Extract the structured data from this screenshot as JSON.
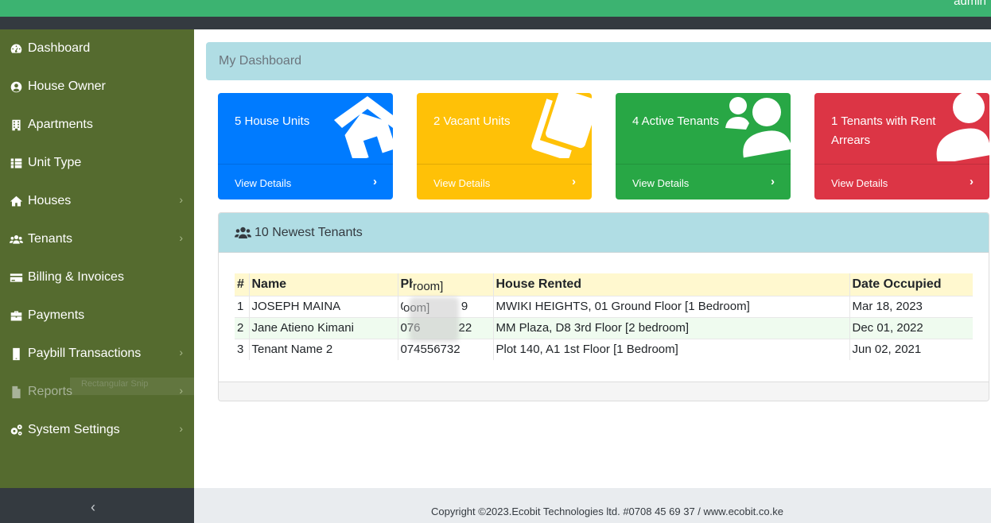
{
  "header": {
    "user": "admin"
  },
  "sidebar": {
    "items": [
      {
        "label": "Dashboard",
        "icon": "tachometer-icon",
        "chevron": false
      },
      {
        "label": "House Owner",
        "icon": "user-circle-icon",
        "chevron": false
      },
      {
        "label": "Apartments",
        "icon": "building-icon",
        "chevron": false
      },
      {
        "label": "Unit Type",
        "icon": "list-icon",
        "chevron": false
      },
      {
        "label": "Houses",
        "icon": "home-icon",
        "chevron": true
      },
      {
        "label": "Tenants",
        "icon": "users-icon",
        "chevron": true
      },
      {
        "label": "Billing & Invoices",
        "icon": "credit-card-icon",
        "chevron": false
      },
      {
        "label": "Payments",
        "icon": "briefcase-icon",
        "chevron": false
      },
      {
        "label": "Paybill Transactions",
        "icon": "mobile-icon",
        "chevron": true
      },
      {
        "label": "Reports",
        "icon": "file-icon",
        "chevron": true
      },
      {
        "label": "System Settings",
        "icon": "cogs-icon",
        "chevron": true
      }
    ],
    "ghost_text": "Rectangular Snip",
    "toggle_icon": "‹"
  },
  "breadcrumb": {
    "title": "My Dashboard"
  },
  "cards": [
    {
      "title": "5 House Units",
      "link": "View Details",
      "arrow": "›",
      "color": "#007bff",
      "icon": "home-icon"
    },
    {
      "title": "2 Vacant Units",
      "link": "View Details",
      "arrow": "›",
      "color": "#ffc107",
      "icon": "copy-icon"
    },
    {
      "title": "4 Active Tenants",
      "link": "View Details",
      "arrow": "›",
      "color": "#28a745",
      "icon": "user-friends-icon"
    },
    {
      "title": "1 Tenants with Rent Arrears",
      "link": "View Details",
      "arrow": "›",
      "color": "#dc3545",
      "icon": "user-icon"
    }
  ],
  "panel": {
    "title": "10 Newest Tenants",
    "columns": [
      "#",
      "Name",
      "Ph",
      "House Rented",
      "Date Occupied"
    ],
    "rows": [
      {
        "n": "1",
        "name": "JOSEPH MAINA",
        "phone": "0",
        "phone_end": "9",
        "house": "MWIKI HEIGHTS, 01 Ground Floor [1 Bedroom]",
        "date": "Mar 18, 2023"
      },
      {
        "n": "2",
        "name": "Jane Atieno Kimani",
        "phone": "076",
        "phone_end": "22",
        "house": "MM Plaza, D8 3rd Floor [2 bedroom]",
        "date": "Dec 01, 2022"
      },
      {
        "n": "3",
        "name": "Tenant Name 2",
        "phone": "074556732",
        "phone_end": "",
        "house": "Plot 140, A1 1st Floor [1 Bedroom]",
        "date": "Jun 02, 2021"
      }
    ],
    "overlay_1": "room]",
    "overlay_2": "oom]"
  },
  "footer": {
    "copyright": "Copyright ©2023.Ecobit Technologies ltd. #0708 45 69 37 / www.ecobit.co.ke"
  }
}
